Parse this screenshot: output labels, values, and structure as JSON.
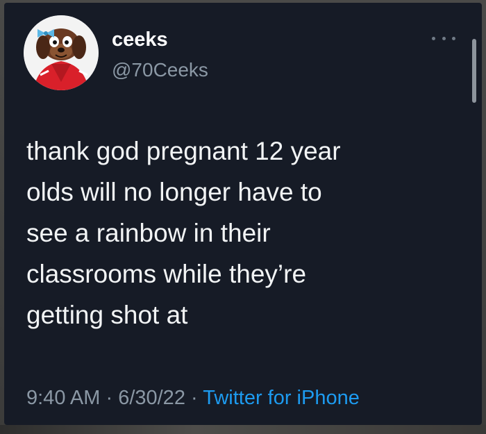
{
  "tweet": {
    "display_name": "ceeks",
    "handle": "@70Ceeks",
    "text": "thank god pregnant 12 year\nolds will no longer have to\nsee a rainbow in their\nclassrooms while they’re\ngetting shot at",
    "time": "9:40 AM",
    "separator": " · ",
    "date": "6/30/22",
    "source": "Twitter for iPhone"
  },
  "icons": {
    "avatar": "cartoon-dog-avatar",
    "more": "more-options-icon"
  },
  "colors": {
    "background": "#161b26",
    "text": "#f2f4f5",
    "secondary": "#8b98a5",
    "link": "#1d9bf0"
  }
}
